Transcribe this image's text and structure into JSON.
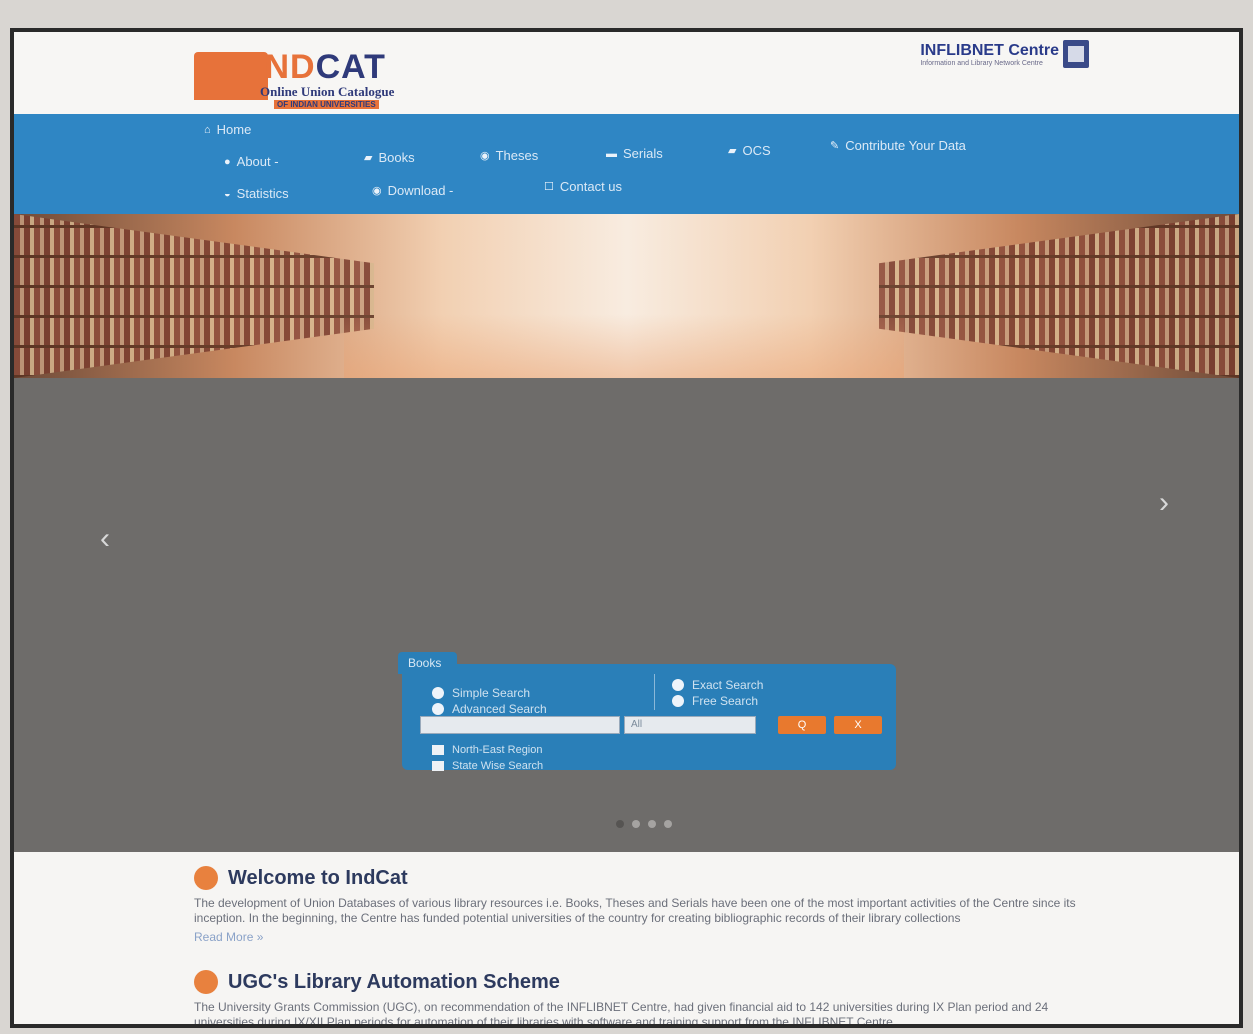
{
  "header": {
    "logo_title_i": "IND",
    "logo_title_rest": "CAT",
    "logo_sub1": "Online Union Catalogue",
    "logo_sub2": "OF INDIAN UNIVERSITIES",
    "partner_title": "INFLIBNET Centre",
    "partner_sub": "Information and Library Network Centre"
  },
  "nav": {
    "home": "Home",
    "about": "About -",
    "books": "Books",
    "theses": "Theses",
    "serials": "Serials",
    "ocs": "OCS",
    "contribute": "Contribute Your Data",
    "statistics": "Statistics",
    "download": "Download -",
    "contact": "Contact us"
  },
  "slider": {
    "prev": "‹",
    "next": "›",
    "active_slide": 1,
    "slide_count": 4
  },
  "search": {
    "tab": "Books",
    "simple": "Simple Search",
    "advanced": "Advanced Search",
    "exact": "Exact Search",
    "free": "Free Search",
    "input_placeholder": "",
    "select_value": "All",
    "go_label": "Q",
    "reset_label": "X",
    "north_east": "North-East Region",
    "state_wise": "State Wise Search"
  },
  "welcome": {
    "title": "Welcome to IndCat",
    "text": "The development of Union Databases of various library resources i.e. Books, Theses and Serials have been one of the most important activities of the Centre since its inception. In the beginning, the Centre has funded potential universities of the country for creating bibliographic records of their library collections",
    "read_more": "Read More »"
  },
  "ugc": {
    "title": "UGC's Library Automation Scheme",
    "text": "The University Grants Commission (UGC), on recommendation of the INFLIBNET Centre, had given financial aid to 142 universities during IX Plan period and 24 universities during IX/XII Plan periods for automation of their libraries with software and training support from the INFLIBNET Centre."
  },
  "colors": {
    "nav_bg": "#2f86c4",
    "accent_orange": "#e8792e",
    "slider_bg": "#6e6c6a",
    "title_navy": "#2d3a5e"
  }
}
